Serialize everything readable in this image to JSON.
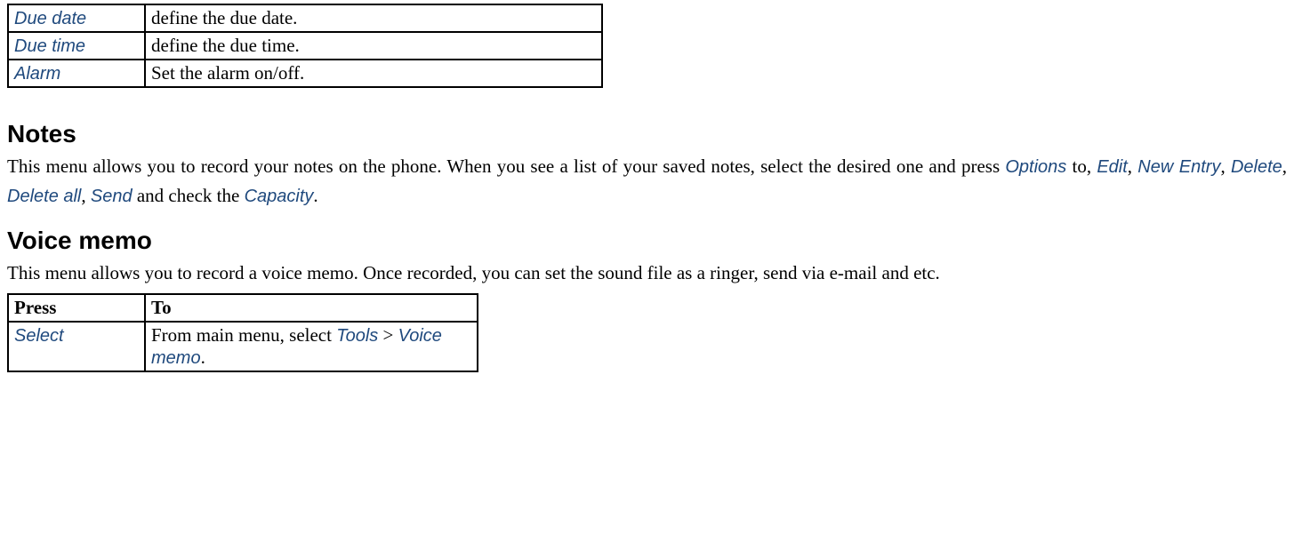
{
  "top_table": {
    "rows": [
      {
        "label": "Due date",
        "desc": "define the due date."
      },
      {
        "label": "Due time",
        "desc": "define the due time."
      },
      {
        "label": "Alarm",
        "desc": "Set the alarm on/off."
      }
    ]
  },
  "notes": {
    "heading": "Notes",
    "p_part1": "This menu allows you to record your notes on the phone. When you see a list of your saved notes, select the desired one and press   ",
    "options": "Options",
    "p_to": " to, ",
    "edit": "Edit",
    "sep1": ", ",
    "new_entry": "New Entry",
    "sep2": ", ",
    "delete": "Delete",
    "sep3": ", ",
    "delete_all": "Delete all",
    "sep4": ", ",
    "send": "Send",
    "p_tail1": " and check the ",
    "capacity": "Capacity",
    "p_tail2": "."
  },
  "voice": {
    "heading": "Voice memo",
    "paragraph": "This menu allows you to record a voice memo. Once recorded, you can set the sound file as a ringer, send via e-mail and etc.",
    "table": {
      "press_header": "Press",
      "to_header": "To",
      "select_label": "Select",
      "desc_part1": "From main menu, select ",
      "tools": "Tools",
      "gt": " > ",
      "voice_memo": "Voice memo",
      "desc_tail": "."
    }
  }
}
